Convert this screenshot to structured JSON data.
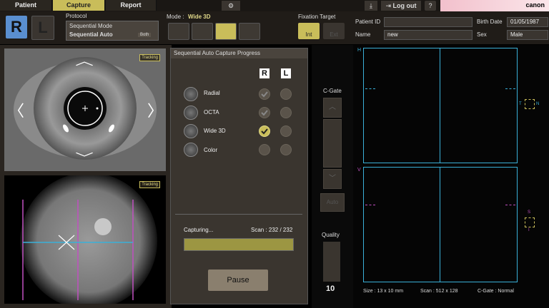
{
  "tabs": [
    {
      "label": "Patient"
    },
    {
      "label": "Capture"
    },
    {
      "label": "Report"
    }
  ],
  "toolbar": {
    "logout_label": "Log out",
    "help_label": "?",
    "brand": "canon"
  },
  "header": {
    "eye_right": "R",
    "eye_left": "L",
    "protocol_label": "Protocol",
    "protocol_line1": "Sequential Mode",
    "protocol_line2": "Sequential Auto",
    "protocol_both": "Both",
    "mode_label": "Mode :",
    "mode_value": "Wide 3D",
    "fixation_label": "Fixation Target",
    "fixation_int": "Int",
    "fixation_ext": "Ext",
    "patient_id_label": "Patient ID",
    "patient_id_value": "",
    "name_label": "Name",
    "name_value": "new",
    "birth_label": "Birth Date",
    "birth_value": "01/05/1987",
    "sex_label": "Sex",
    "sex_value": "Male"
  },
  "anterior": {
    "tracking": "Tracking"
  },
  "fundus": {
    "tracking": "Tracking"
  },
  "progress": {
    "title": "Sequential Auto Capture Progress",
    "col_r": "R",
    "col_l": "L",
    "rows": [
      {
        "label": "Radial",
        "r": "done",
        "l": "pending"
      },
      {
        "label": "OCTA",
        "r": "done",
        "l": "pending"
      },
      {
        "label": "Wide 3D",
        "r": "active",
        "l": "pending"
      },
      {
        "label": "Color",
        "r": "pending",
        "l": "pending"
      }
    ],
    "status": "Capturing...",
    "scan_label": "Scan : 232 / 232",
    "progress_fraction": 1.0,
    "pause_label": "Pause"
  },
  "side": {
    "cgate_label": "C-Gate",
    "auto_label": "Auto",
    "quality_label": "Quality",
    "quality_value": "10"
  },
  "oct": {
    "h_label": "H",
    "v_label": "V",
    "t_label": "T",
    "n_label": "N",
    "s_label": "S",
    "i_label": "I",
    "size_label": "Size : 13 x 10 mm",
    "scan_label": "Scan : 512 x 128",
    "cgate_label": "C-Gate : Normal"
  },
  "colors": {
    "accent": "#c9bd5a",
    "cyan": "#3ab0d8",
    "magenta": "#c050c0"
  }
}
